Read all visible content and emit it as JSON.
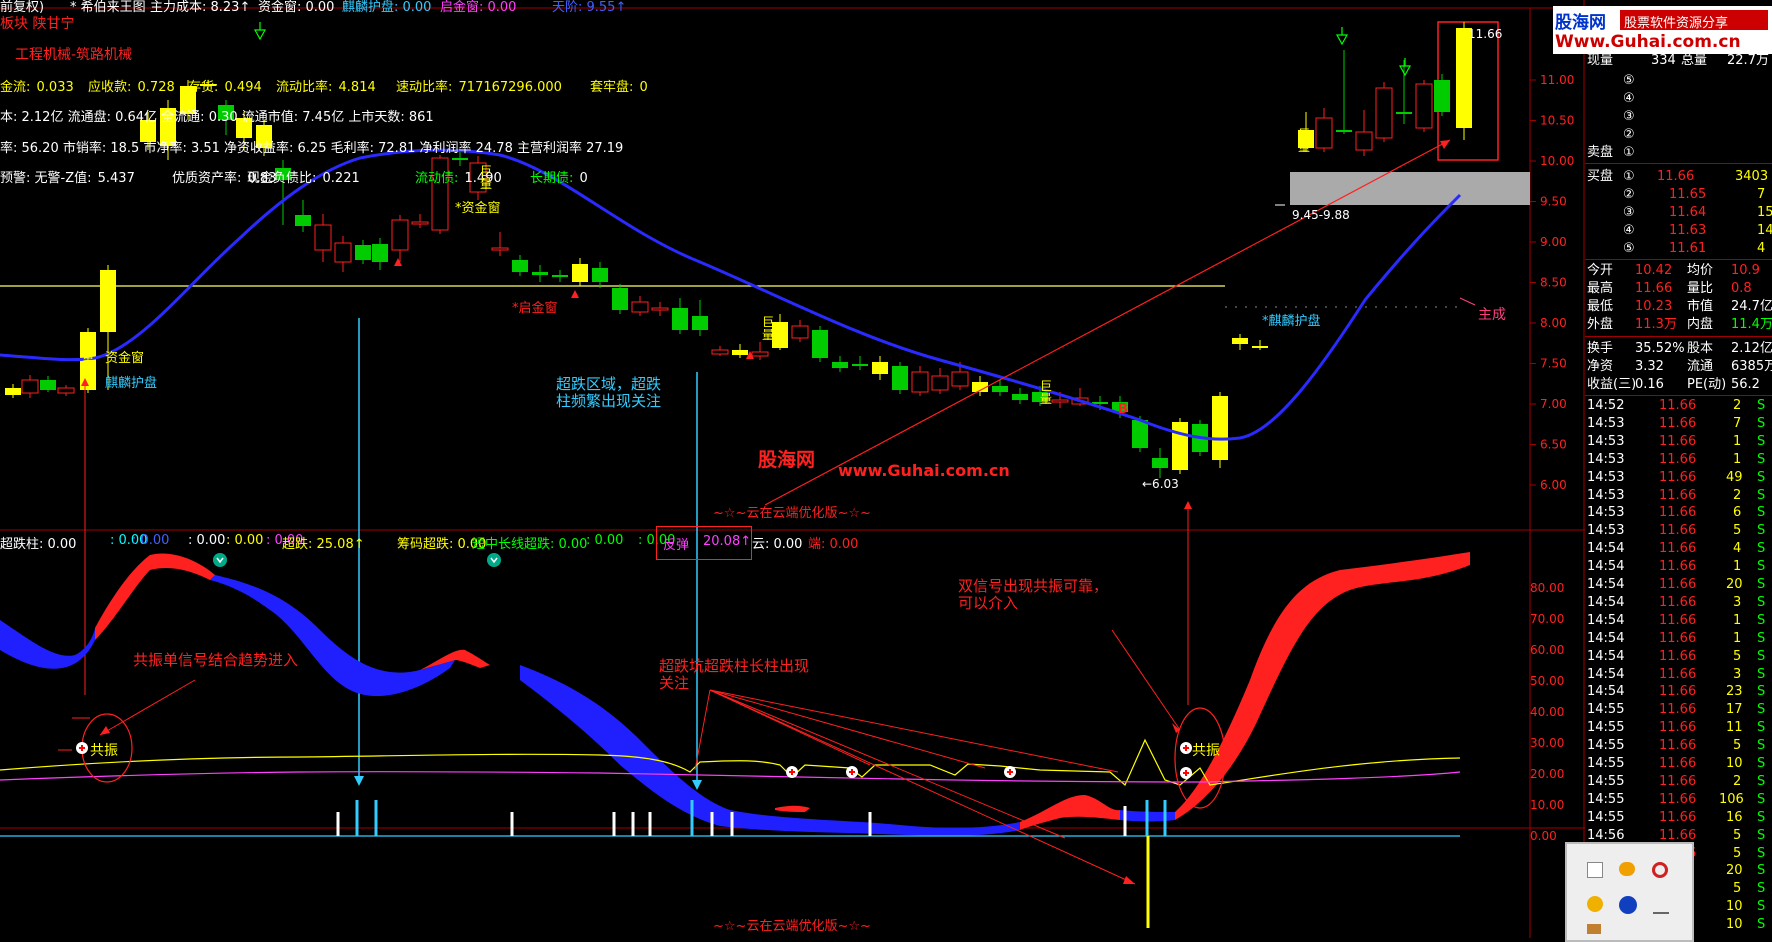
{
  "header": {
    "items": [
      {
        "text": "前复权)",
        "color": "#ffffff"
      },
      {
        "text": "* 希伯来王图",
        "color": "#ffffff"
      },
      {
        "text": "主力成本: 8.23↑",
        "color": "#ffffff"
      },
      {
        "text": "资金窗: 0.00",
        "color": "#ffffff"
      },
      {
        "text": "麒麟护盘: 0.00",
        "color": "#33ccff"
      },
      {
        "text": "启金窗: 0.00",
        "color": "#ff40ff"
      },
      {
        "text": "天阶: 9.55↑",
        "color": "#4060ff"
      }
    ]
  },
  "sector": "板块 陕甘宁",
  "industry": "工程机械-筑路机械",
  "finance": {
    "row1": [
      {
        "label": "金流:",
        "value": "0.033"
      },
      {
        "label": "应收款:",
        "value": "0.728"
      },
      {
        "label": "存货:",
        "value": "0.494"
      },
      {
        "label": "流动比率:",
        "value": "4.814"
      },
      {
        "label": "速动比率:",
        "value": "717167296.000"
      },
      {
        "label": "套牢盘:",
        "value": "0"
      }
    ],
    "row2": "本: 2.12亿 流通盘: 0.64亿 全流通: 0.30 流通市值: 7.45亿 上市天数: 861",
    "row3": "率: 56.20 市销率: 18.5 市净率: 3.51 净资收益率: 6.25 毛利率: 72.81 净利润率 24.78 主营利润率 27.19",
    "row4": [
      {
        "label": "预警: 无警-Z值:",
        "value": "5.437"
      },
      {
        "label": "优质资产率:",
        "value": "0.83"
      },
      {
        "label": "现金负债比:",
        "value": "0.221"
      },
      {
        "label": "流动债:",
        "value": "1.490"
      },
      {
        "label": "长期债:",
        "value": "0"
      }
    ]
  },
  "price_labels": {
    "zijinchuang_1": "资金窗",
    "zijinchuang_2": "*资金窗",
    "hongjinchuang": "*启金窗",
    "qilin_1": "麒麟护盘",
    "qilin_2": "*麒麟护盘",
    "zhucheng": "主成",
    "jubliang": "巨量",
    "b_mark": "B",
    "low": "←6.03",
    "high": "11.66",
    "range": "9.45-9.88"
  },
  "price_axis": [
    "11.00",
    "10.50",
    "10.00",
    "9.50",
    "9.00",
    "8.50",
    "8.00",
    "7.50",
    "7.00",
    "6.50",
    "6.00"
  ],
  "annotations": {
    "chaodie_zone": [
      "超跌区域，超跌",
      "柱频繁出现关注"
    ],
    "watermark": "股海网",
    "watermark_url": "www.Guhai.com.cn",
    "footer1": "~☆~云在云端优化版~☆~",
    "footer2": "~☆~云在云端优化版~☆~",
    "gongzhen_single": "共振单信号结合趋势进入",
    "chaodie_kang": [
      "超跌坑超跌柱长柱出现",
      "关注"
    ],
    "double_signal": [
      "双信号出现共振可靠，",
      "可以介入"
    ],
    "gongzhen_label1": "共振",
    "gongzhen_label2": "共振"
  },
  "indicator_header": [
    {
      "text": "超跌柱: 0.00",
      "color": "#ffffff"
    },
    {
      "text": ": 0.00",
      "color": "#00ffff"
    },
    {
      "text": ": 0.00",
      "color": "#4060ff"
    },
    {
      "text": ": 0.00",
      "color": "#ffffff"
    },
    {
      "text": ": 0.00",
      "color": "#ffff00"
    },
    {
      "text": ": 0.00",
      "color": "#ff40ff"
    },
    {
      "text": "超跌: 25.08↑",
      "color": "#ffff00"
    },
    {
      "text": "筹码超跌: 0.00",
      "color": "#ffff00"
    },
    {
      "text": "短中长线超跌: 0.00",
      "color": "#00ff00"
    },
    {
      "text": ": 0.00",
      "color": "#00ff00"
    },
    {
      "text": ": 0.00",
      "color": "#00ff00"
    }
  ],
  "fantan": {
    "label": "反弹",
    "value": "20.08↑"
  },
  "indicator_tail": [
    {
      "text": "云: 0.00",
      "color": "#ffffff"
    },
    {
      "text": "端: 0.00",
      "color": "#ff2020"
    }
  ],
  "indicator_axis": [
    "80.00",
    "70.00",
    "60.00",
    "50.00",
    "40.00",
    "30.00",
    "20.00",
    "10.00",
    "0.00"
  ],
  "banner": {
    "title": "股海网",
    "slogan": "股票软件资源分享",
    "url": "Www.Guhai.com.cn"
  },
  "quote": {
    "xianliang_label": "现量",
    "xianliang": "334",
    "zongliang_label": "总量",
    "zongliang": "22.7万",
    "sell": [
      {
        "n": "⑤"
      },
      {
        "n": "④"
      },
      {
        "n": "③"
      },
      {
        "n": "②"
      },
      {
        "n": "①",
        "label": "卖盘"
      }
    ],
    "buy": [
      {
        "label": "买盘",
        "n": "①",
        "price": "11.66",
        "vol": "3403"
      },
      {
        "n": "②",
        "price": "11.65",
        "vol": "7"
      },
      {
        "n": "③",
        "price": "11.64",
        "vol": "15"
      },
      {
        "n": "④",
        "price": "11.63",
        "vol": "14"
      },
      {
        "n": "⑤",
        "price": "11.61",
        "vol": "4"
      }
    ],
    "stats": [
      {
        "l1": "今开",
        "v1": "10.42",
        "c1": "#ff2020",
        "l2": "均价",
        "v2": "10.9",
        "c2": "#ff2020"
      },
      {
        "l1": "最高",
        "v1": "11.66",
        "c1": "#ff2020",
        "l2": "量比",
        "v2": "0.8",
        "c2": "#ff2020"
      },
      {
        "l1": "最低",
        "v1": "10.23",
        "c1": "#ff2020",
        "l2": "市值",
        "v2": "24.7亿",
        "c2": "#ffffff"
      },
      {
        "l1": "外盘",
        "v1": "11.3万",
        "c1": "#ff2020",
        "l2": "内盘",
        "v2": "11.4万",
        "c2": "#00ff00"
      },
      {
        "l1": "换手",
        "v1": "35.52%",
        "c1": "#ffffff",
        "l2": "股本",
        "v2": "2.12亿",
        "c2": "#ffffff"
      },
      {
        "l1": "净资",
        "v1": "3.32",
        "c1": "#ffffff",
        "l2": "流通",
        "v2": "6385万",
        "c2": "#ffffff"
      },
      {
        "l1": "收益(三)",
        "v1": "0.16",
        "c1": "#ffffff",
        "l2": "PE(动)",
        "v2": "56.2",
        "c2": "#ffffff"
      }
    ],
    "ticks": [
      {
        "t": "14:52",
        "p": "11.66",
        "v": "2",
        "s": "S"
      },
      {
        "t": "14:53",
        "p": "11.66",
        "v": "7",
        "s": "S"
      },
      {
        "t": "14:53",
        "p": "11.66",
        "v": "1",
        "s": "S"
      },
      {
        "t": "14:53",
        "p": "11.66",
        "v": "1",
        "s": "S"
      },
      {
        "t": "14:53",
        "p": "11.66",
        "v": "49",
        "s": "S"
      },
      {
        "t": "14:53",
        "p": "11.66",
        "v": "2",
        "s": "S"
      },
      {
        "t": "14:53",
        "p": "11.66",
        "v": "6",
        "s": "S"
      },
      {
        "t": "14:53",
        "p": "11.66",
        "v": "5",
        "s": "S"
      },
      {
        "t": "14:54",
        "p": "11.66",
        "v": "4",
        "s": "S"
      },
      {
        "t": "14:54",
        "p": "11.66",
        "v": "1",
        "s": "S"
      },
      {
        "t": "14:54",
        "p": "11.66",
        "v": "20",
        "s": "S"
      },
      {
        "t": "14:54",
        "p": "11.66",
        "v": "3",
        "s": "S"
      },
      {
        "t": "14:54",
        "p": "11.66",
        "v": "1",
        "s": "S"
      },
      {
        "t": "14:54",
        "p": "11.66",
        "v": "1",
        "s": "S"
      },
      {
        "t": "14:54",
        "p": "11.66",
        "v": "5",
        "s": "S"
      },
      {
        "t": "14:54",
        "p": "11.66",
        "v": "3",
        "s": "S"
      },
      {
        "t": "14:54",
        "p": "11.66",
        "v": "23",
        "s": "S"
      },
      {
        "t": "14:55",
        "p": "11.66",
        "v": "17",
        "s": "S"
      },
      {
        "t": "14:55",
        "p": "11.66",
        "v": "11",
        "s": "S"
      },
      {
        "t": "14:55",
        "p": "11.66",
        "v": "5",
        "s": "S"
      },
      {
        "t": "14:55",
        "p": "11.66",
        "v": "10",
        "s": "S"
      },
      {
        "t": "14:55",
        "p": "11.66",
        "v": "2",
        "s": "S"
      },
      {
        "t": "14:55",
        "p": "11.66",
        "v": "106",
        "s": "S"
      },
      {
        "t": "14:55",
        "p": "11.66",
        "v": "16",
        "s": "S"
      },
      {
        "t": "14:56",
        "p": "11.66",
        "v": "5",
        "s": "S"
      },
      {
        "t": "14:56",
        "p": "11.66",
        "v": "5",
        "s": "S"
      },
      {
        "t": "",
        "p": "",
        "v": "20",
        "s": "S"
      },
      {
        "t": "",
        "p": "",
        "v": "5",
        "s": "S"
      },
      {
        "t": "",
        "p": "",
        "v": "10",
        "s": "S"
      },
      {
        "t": "",
        "p": "",
        "v": "10",
        "s": "S"
      }
    ]
  },
  "colors": {
    "up": "#ff2020",
    "down": "#00cc00",
    "yellow": "#ffff00",
    "ma_blue": "#2020ff",
    "cyan": "#33ccff"
  }
}
